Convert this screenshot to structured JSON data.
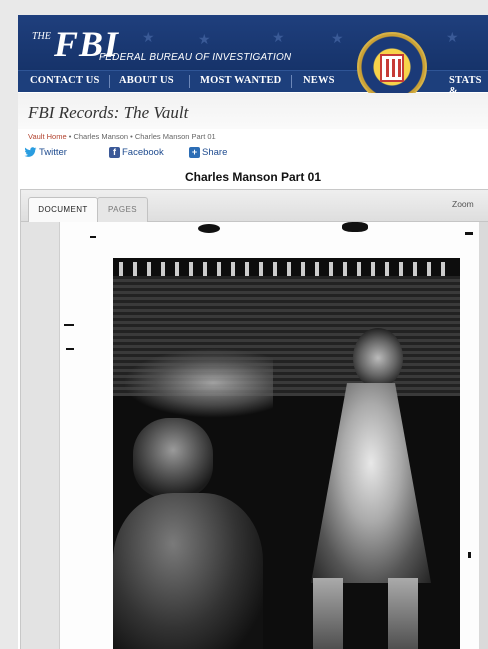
{
  "header": {
    "logo_the": "THE",
    "logo_fbi": "FBI",
    "logo_subtitle": "FEDERAL BUREAU OF INVESTIGATION",
    "nav": [
      "CONTACT US",
      "ABOUT US",
      "MOST WANTED",
      "NEWS",
      "STATS &"
    ]
  },
  "vault": {
    "title": "FBI Records: The Vault"
  },
  "breadcrumb": {
    "home": "Vault Home",
    "sep1": " • ",
    "level2": "Charles Manson",
    "sep2": " • ",
    "level3": "Charles Manson Part 01"
  },
  "social": {
    "twitter": "Twitter",
    "facebook": "Facebook",
    "share": "Share"
  },
  "document": {
    "title": "Charles Manson Part 01"
  },
  "viewer": {
    "tab_document": "DOCUMENT",
    "tab_pages": "PAGES",
    "zoom_label": "Zoom"
  },
  "colors": {
    "banner": "#1f3f7d",
    "link": "#1e4b8f",
    "breadcrumb_home": "#b2432f"
  }
}
